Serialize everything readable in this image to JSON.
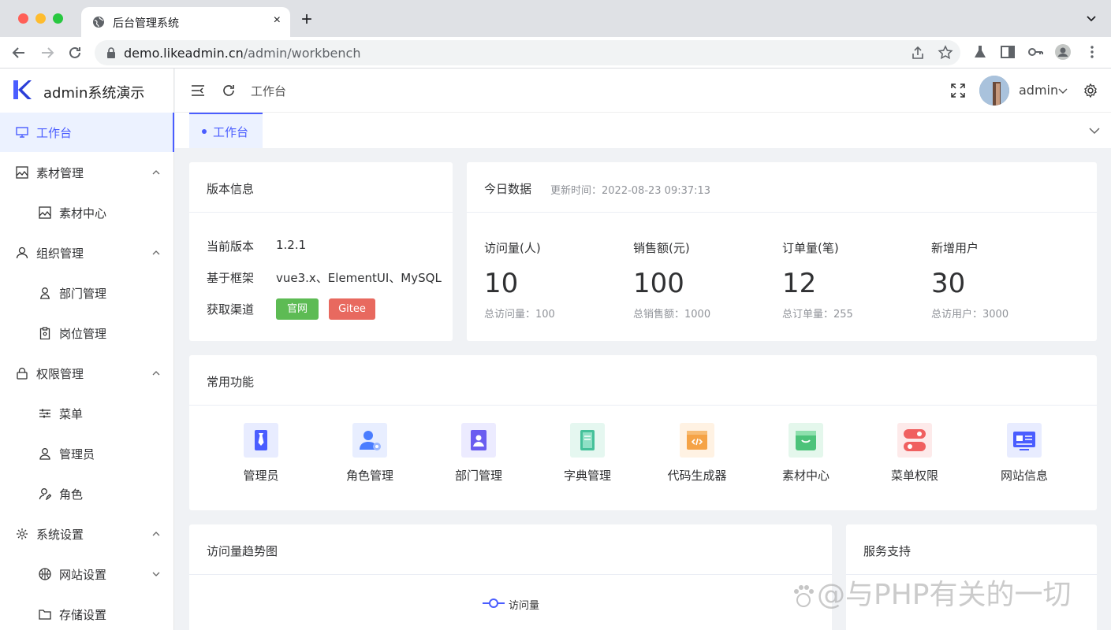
{
  "browser": {
    "tab_title": "后台管理系统",
    "tab_close": "×",
    "new_tab": "+",
    "url_host": "demo.likeadmin.cn",
    "url_path": "/admin/workbench"
  },
  "app": {
    "name": "admin系统演示"
  },
  "sidebar": {
    "items": [
      {
        "label": "工作台"
      },
      {
        "label": "素材管理"
      },
      {
        "label": "素材中心"
      },
      {
        "label": "组织管理"
      },
      {
        "label": "部门管理"
      },
      {
        "label": "岗位管理"
      },
      {
        "label": "权限管理"
      },
      {
        "label": "菜单"
      },
      {
        "label": "管理员"
      },
      {
        "label": "角色"
      },
      {
        "label": "系统设置"
      },
      {
        "label": "网站设置"
      },
      {
        "label": "存储设置"
      }
    ]
  },
  "header": {
    "breadcrumb": "工作台",
    "username": "admin"
  },
  "tabs": [
    {
      "label": "工作台"
    }
  ],
  "version_card": {
    "title": "版本信息",
    "rows": [
      {
        "label": "当前版本",
        "value": "1.2.1"
      },
      {
        "label": "基于框架",
        "value": "vue3.x、ElementUI、MySQL"
      },
      {
        "label": "获取渠道"
      }
    ],
    "tags": [
      "官网",
      "Gitee"
    ]
  },
  "today_card": {
    "title": "今日数据",
    "update_time": "更新时间：2022-08-23 09:37:13",
    "stats": [
      {
        "label": "访问量(人)",
        "value": "10",
        "sub": "总访问量：100"
      },
      {
        "label": "销售额(元)",
        "value": "100",
        "sub": "总销售额：1000"
      },
      {
        "label": "订单量(笔)",
        "value": "12",
        "sub": "总订单量：255"
      },
      {
        "label": "新增用户",
        "value": "30",
        "sub": "总访用户：3000"
      }
    ]
  },
  "functions_card": {
    "title": "常用功能",
    "items": [
      {
        "label": "管理员",
        "icon": "tie-icon",
        "color": "#4a5dff"
      },
      {
        "label": "角色管理",
        "icon": "user-gear-icon",
        "color": "#4a7dff"
      },
      {
        "label": "部门管理",
        "icon": "badge-icon",
        "color": "#6a5df0"
      },
      {
        "label": "字典管理",
        "icon": "book-icon",
        "color": "#45c19a"
      },
      {
        "label": "代码生成器",
        "icon": "code-window-icon",
        "color": "#f5a346"
      },
      {
        "label": "素材中心",
        "icon": "basket-icon",
        "color": "#4cc37a"
      },
      {
        "label": "菜单权限",
        "icon": "toggle-icon",
        "color": "#f06060"
      },
      {
        "label": "网站信息",
        "icon": "id-card-icon",
        "color": "#4a5dff"
      }
    ]
  },
  "trend_card": {
    "title": "访问量趋势图",
    "legend": "访问量"
  },
  "service_card": {
    "title": "服务支持"
  },
  "watermark": "@与PHP有关的一切",
  "colors": {
    "primary": "#4a5dff",
    "success": "#5dbb54",
    "danger": "#e8695f"
  }
}
